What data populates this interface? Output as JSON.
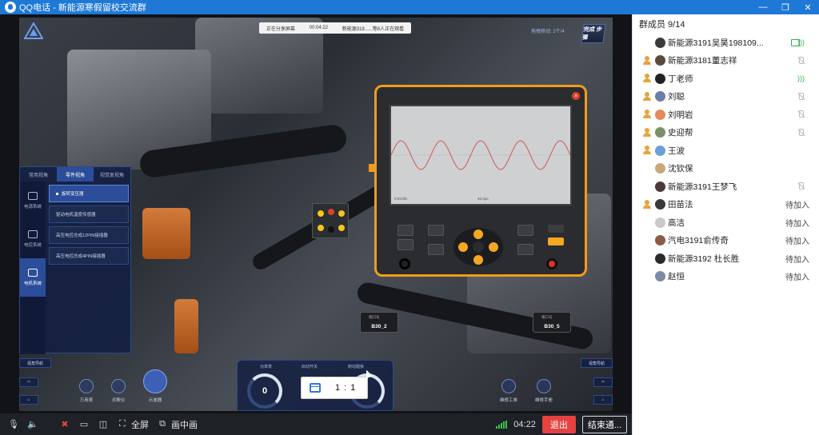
{
  "window": {
    "title": "QQ电话 - 新能源寒假留校交流群",
    "controls": [
      "—",
      "❐",
      "✕"
    ]
  },
  "share_banner": {
    "status": "正在分享屏幕",
    "time": "00:04:22",
    "viewers": "新能源319......等8人正在观看"
  },
  "scene": {
    "top_right_label": "拖拽移动: 2个/4",
    "done_label": "完成 步骤",
    "left_panel": {
      "tabs": [
        "常用视角",
        "零件视角",
        "视觉复视角"
      ],
      "active_tab": 1,
      "side_items": [
        "电源系统",
        "电控系统",
        "电机系统"
      ],
      "active_side": 2,
      "list_items": [
        "旋转变压器",
        "驱动电机温度传感器",
        "高压电控总成12PIN接插器",
        "高压电控总成4PIN接插器"
      ],
      "active_item": 0
    },
    "oscilloscope": {
      "left_label": "0.5V/div",
      "mid_label": "40.0μs"
    },
    "port_left": {
      "key": "端口号",
      "value": "B30_2"
    },
    "port_right": {
      "key": "端口号",
      "value": "B30_5"
    },
    "nav_left": "视角导航",
    "nav_right": "视角导航",
    "tools_left": [
      "万用表",
      "诊断仪",
      "示波器"
    ],
    "tools_right": [
      "维修工单",
      "维修手册"
    ],
    "gauge_panel": {
      "labels": [
        "功率表",
        "启动开关",
        "制动踏板"
      ],
      "gauge_value": "0"
    },
    "zoom": "1 : 1"
  },
  "callbar": {
    "fullscreen": "全屏",
    "pip": "画中画",
    "timer": "04:22",
    "exit": "退出",
    "end": "结束通..."
  },
  "members": {
    "header": "群成员 9/14",
    "list": [
      {
        "name": "新能源3191吴昊198109...",
        "status": "",
        "mic": "share",
        "host": false,
        "avatar": "#3b3b3b"
      },
      {
        "name": "新能源3181董志祥",
        "status": "",
        "mic": "off",
        "host": true,
        "avatar": "#5a4b3a"
      },
      {
        "name": "丁老师",
        "status": "",
        "mic": "on",
        "host": true,
        "avatar": "#222222"
      },
      {
        "name": "刘聪",
        "status": "",
        "mic": "off",
        "host": true,
        "avatar": "#6c7ea8"
      },
      {
        "name": "刘明岩",
        "status": "",
        "mic": "off",
        "host": true,
        "avatar": "#e48b5c"
      },
      {
        "name": "史迎帮",
        "status": "",
        "mic": "off",
        "host": true,
        "avatar": "#7a8f6a"
      },
      {
        "name": "王波",
        "status": "",
        "mic": "none",
        "host": true,
        "avatar": "#6a9fd8"
      },
      {
        "name": "沈钦保",
        "status": "",
        "mic": "none",
        "host": false,
        "avatar": "#c8a878"
      },
      {
        "name": "新能源3191王梦飞",
        "status": "",
        "mic": "off",
        "host": false,
        "avatar": "#4a3a3a"
      },
      {
        "name": "田苗法",
        "status": "待加入",
        "mic": "none",
        "host": true,
        "avatar": "#3a3a3a"
      },
      {
        "name": "高洁",
        "status": "待加入",
        "mic": "none",
        "host": false,
        "avatar": "#c9c9c9"
      },
      {
        "name": "汽电3191俞传奇",
        "status": "待加入",
        "mic": "none",
        "host": false,
        "avatar": "#8a5a4a"
      },
      {
        "name": "新能源3192 杜长胜",
        "status": "待加入",
        "mic": "none",
        "host": false,
        "avatar": "#2a2a2a"
      },
      {
        "name": "赵恒",
        "status": "待加入",
        "mic": "none",
        "host": false,
        "avatar": "#7a8aa8"
      }
    ]
  },
  "colors": {
    "title_bar": "#1e78d6",
    "osc_frame": "#f39a1c",
    "exit": "#e64340",
    "mic_on": "#29b24a"
  }
}
